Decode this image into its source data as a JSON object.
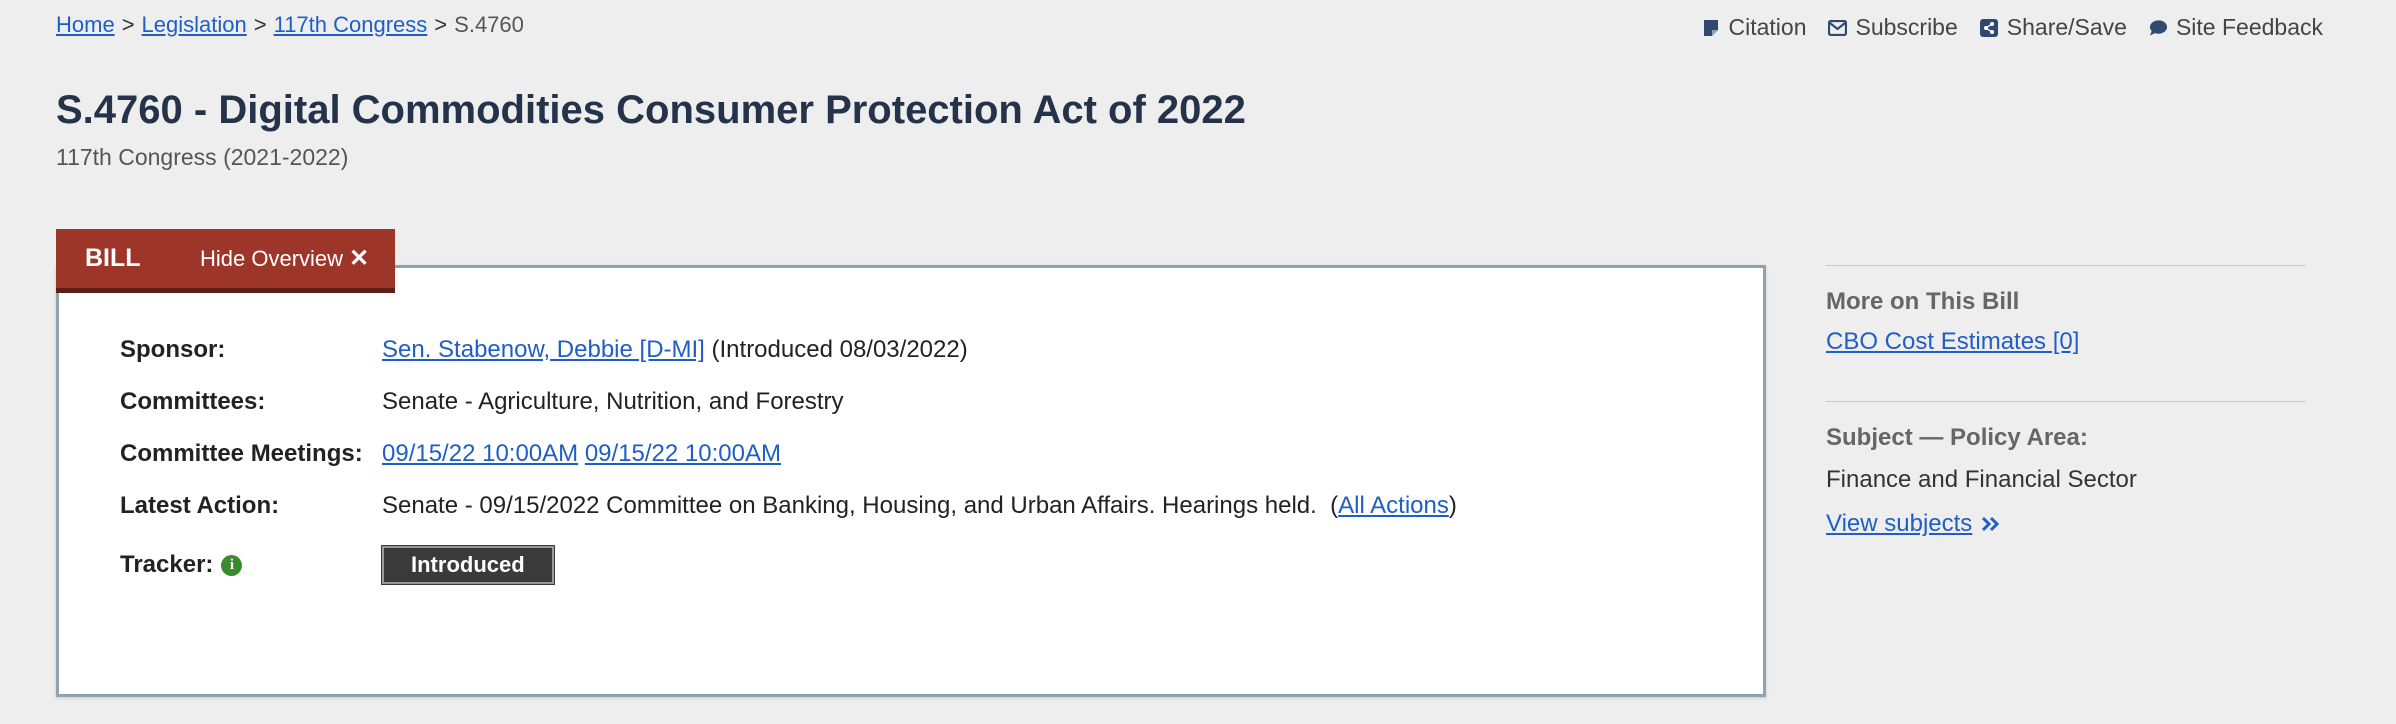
{
  "breadcrumb": {
    "home": "Home",
    "legislation": "Legislation",
    "congress": "117th Congress",
    "current": "S.4760",
    "separator": ">"
  },
  "utility": {
    "citation": "Citation",
    "subscribe": "Subscribe",
    "share_save": "Share/Save",
    "feedback": "Site Feedback"
  },
  "title": "S.4760 - Digital Commodities Consumer Protection Act of 2022",
  "subtitle": "117th Congress (2021-2022)",
  "tabs": {
    "bill": "BILL",
    "hide_overview": "Hide Overview"
  },
  "overview": {
    "sponsor_label": "Sponsor:",
    "sponsor_link": "Sen. Stabenow, Debbie [D-MI]",
    "sponsor_note": "(Introduced 08/03/2022)",
    "committees_label": "Committees:",
    "committees_value": "Senate - Agriculture, Nutrition, and Forestry",
    "meetings_label": "Committee Meetings:",
    "meeting_1": "09/15/22 10:00AM",
    "meeting_2": "09/15/22 10:00AM",
    "latest_action_label": "Latest Action:",
    "latest_action_text": "Senate - 09/15/2022 Committee on Banking, Housing, and Urban Affairs. Hearings held.",
    "all_actions": "All Actions",
    "tracker_label": "Tracker:",
    "tracker_status": "Introduced"
  },
  "sidebar": {
    "more_heading": "More on This Bill",
    "cbo_link": "CBO Cost Estimates [0]",
    "subject_heading": "Subject — Policy Area:",
    "policy_area": "Finance and Financial Sector",
    "view_subjects": "View subjects"
  },
  "colors": {
    "background": "#eeeeee",
    "link": "#1f5ec6",
    "tab": "#9d3628",
    "title": "#25334a",
    "tracker": "#3a3a3a",
    "info_icon": "#3c8a2e"
  }
}
